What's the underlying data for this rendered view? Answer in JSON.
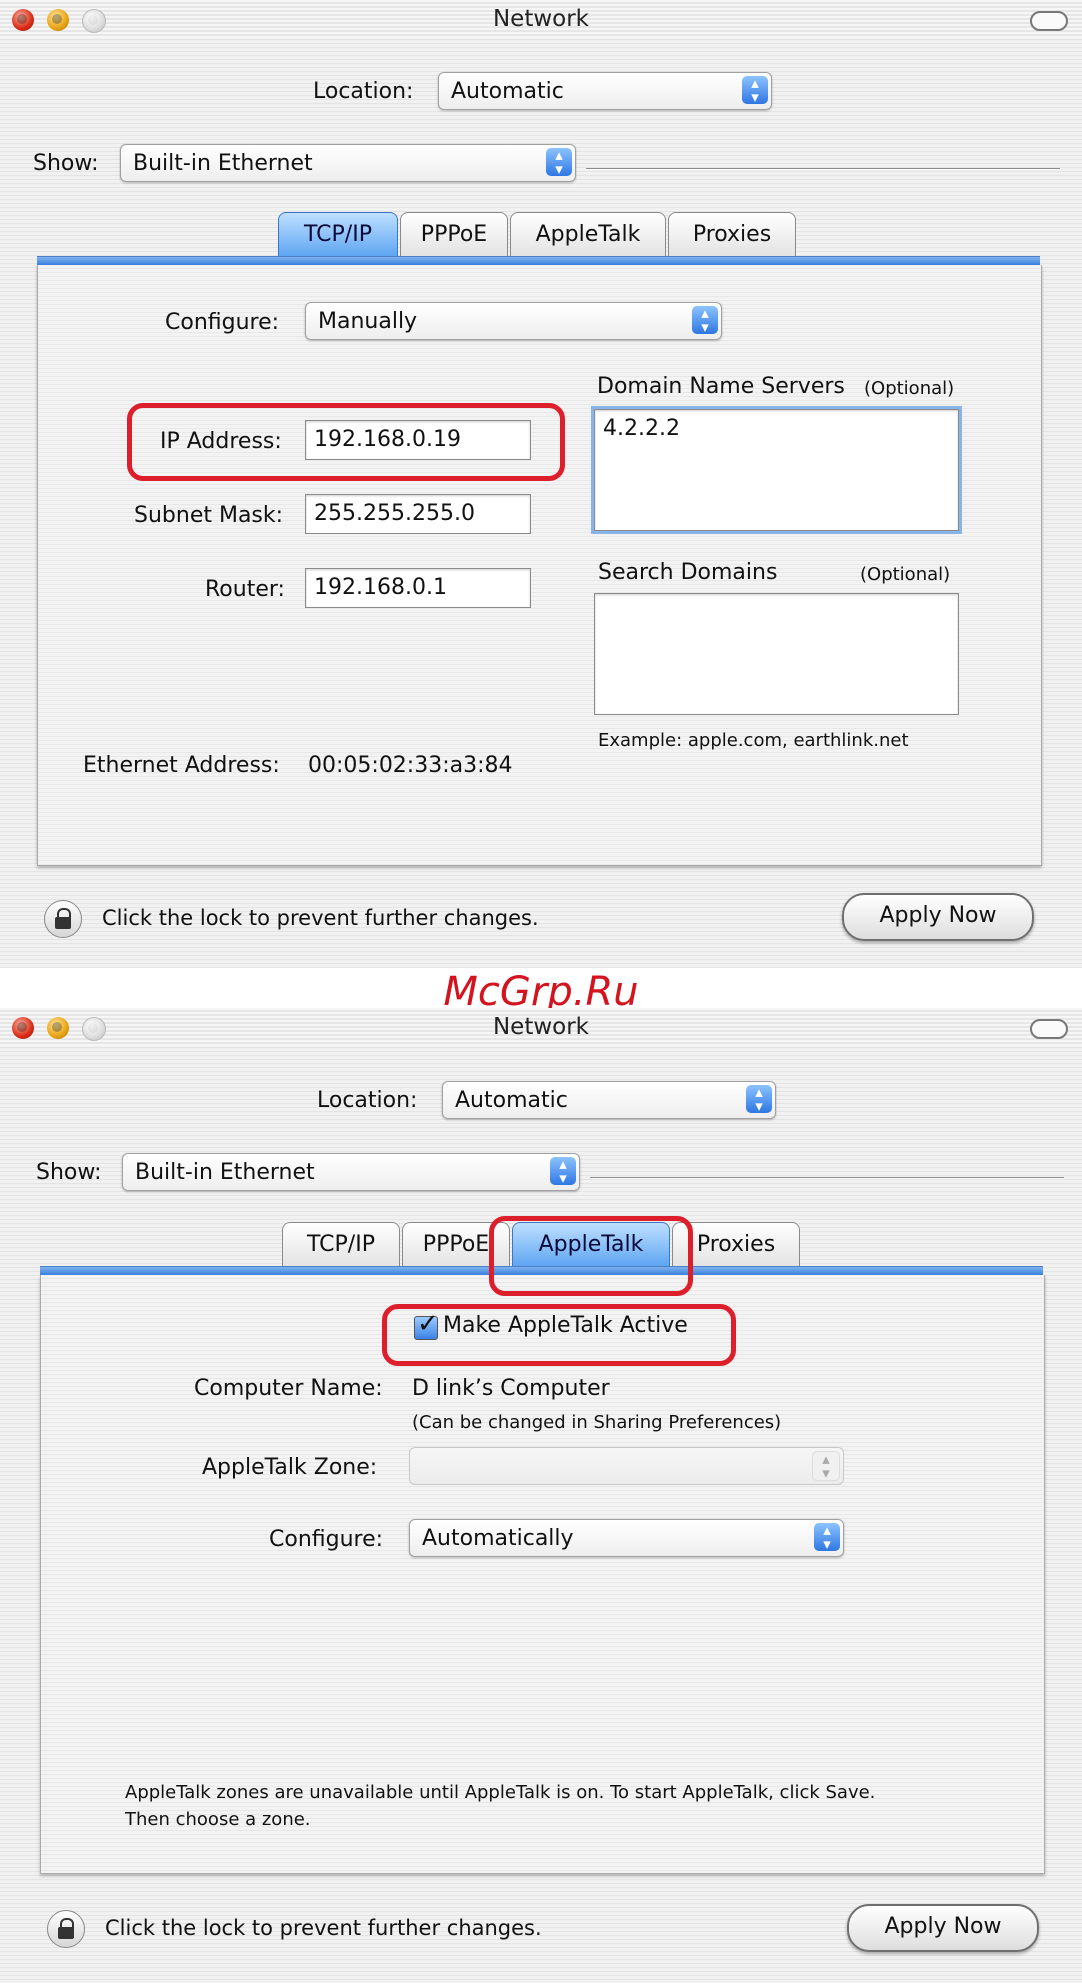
{
  "windows": [
    {
      "title": "Network",
      "location_label": "Location:",
      "location_value": "Automatic",
      "show_label": "Show:",
      "show_value": "Built-in Ethernet",
      "tabs": [
        "TCP/IP",
        "PPPoE",
        "AppleTalk",
        "Proxies"
      ],
      "active_tab": "TCP/IP",
      "tcpip": {
        "configure_label": "Configure:",
        "configure_value": "Manually",
        "ip_label": "IP Address:",
        "ip_value": "192.168.0.19",
        "subnet_label": "Subnet Mask:",
        "subnet_value": "255.255.255.0",
        "router_label": "Router:",
        "router_value": "192.168.0.1",
        "dns_label": "Domain Name Servers",
        "dns_optional": "(Optional)",
        "dns_value": "4.2.2.2",
        "search_label": "Search Domains",
        "search_optional": "(Optional)",
        "search_value": "",
        "example_text": "Example: apple.com, earthlink.net",
        "ethernet_label": "Ethernet Address:",
        "ethernet_value": "00:05:02:33:a3:84"
      },
      "lock_text": "Click the lock to prevent further changes.",
      "apply_label": "Apply Now"
    },
    {
      "title": "Network",
      "location_label": "Location:",
      "location_value": "Automatic",
      "show_label": "Show:",
      "show_value": "Built-in Ethernet",
      "tabs": [
        "TCP/IP",
        "PPPoE",
        "AppleTalk",
        "Proxies"
      ],
      "active_tab": "AppleTalk",
      "appletalk": {
        "active_checkbox_label": "Make AppleTalk Active",
        "active_checked": true,
        "computer_name_label": "Computer Name:",
        "computer_name_value": "D link’s Computer",
        "computer_name_note": "(Can be changed in Sharing Preferences)",
        "zone_label": "AppleTalk Zone:",
        "zone_value": "",
        "configure_label": "Configure:",
        "configure_value": "Automatically",
        "info_line1": "AppleTalk zones are unavailable until AppleTalk is on. To start AppleTalk, click Save.",
        "info_line2": "Then choose a zone."
      },
      "lock_text": "Click the lock to prevent further changes.",
      "apply_label": "Apply Now"
    }
  ],
  "watermark": "McGrp.Ru",
  "colors": {
    "highlight": "#dc1f2b",
    "tab_accent": "#3c82e0",
    "watermark": "#d4131f"
  },
  "icons": [
    "close-light-icon",
    "minimize-light-icon",
    "zoom-light-icon",
    "toolbar-toggle-icon",
    "popup-arrows-icon",
    "lock-icon",
    "checkmark-icon"
  ]
}
